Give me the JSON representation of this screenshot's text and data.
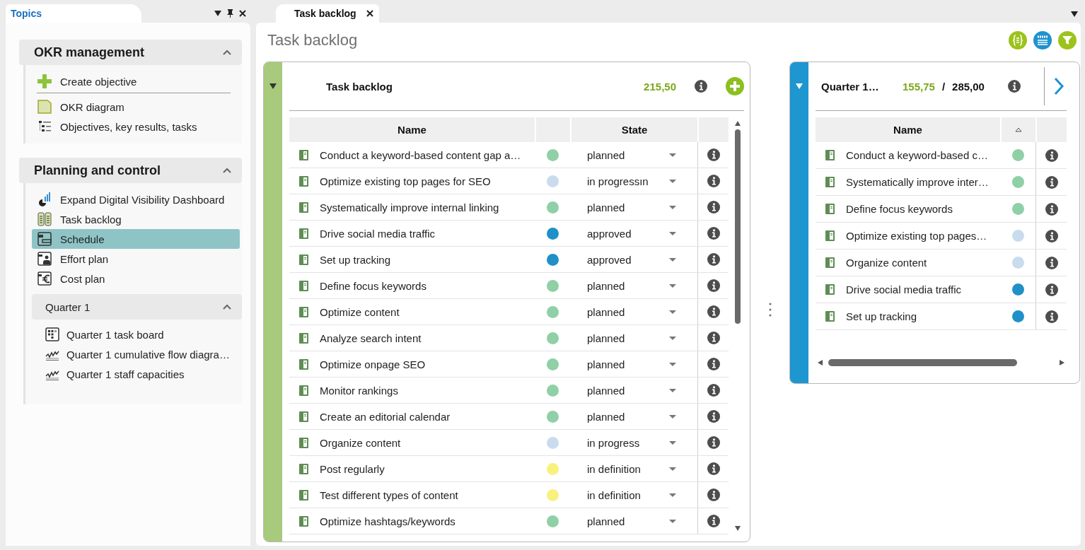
{
  "topics_panel": {
    "tab": {
      "label": "Topics",
      "selected": true
    },
    "sections": [
      {
        "title": "OKR management",
        "expanded": true,
        "items": [
          {
            "label": "Create objective",
            "kind": "create",
            "selected": false
          },
          {
            "label": "OKR diagram",
            "kind": "diagram",
            "selected": false
          },
          {
            "label": "Objectives, key results, tasks",
            "kind": "outline",
            "selected": false
          }
        ]
      },
      {
        "title": "Planning and control",
        "expanded": true,
        "items": [
          {
            "label": "Expand Digital Visibility Dashboard",
            "kind": "dashboard",
            "selected": false
          },
          {
            "label": "Task backlog",
            "kind": "backlog",
            "selected": false
          },
          {
            "label": "Schedule",
            "kind": "schedule",
            "selected": true
          },
          {
            "label": "Effort plan",
            "kind": "effort",
            "selected": false
          },
          {
            "label": "Cost plan",
            "kind": "cost",
            "selected": false
          }
        ],
        "groups": [
          {
            "title": "Quarter 1",
            "expanded": true,
            "items": [
              {
                "label": "Quarter 1 task board",
                "kind": "board",
                "selected": false
              },
              {
                "label": "Quarter 1 cumulative flow diagra…",
                "kind": "chart",
                "selected": false
              },
              {
                "label": "Quarter 1 staff capacities",
                "kind": "chart",
                "selected": false
              }
            ]
          }
        ]
      }
    ]
  },
  "document_tabs": [
    {
      "label": "Task backlog",
      "selected": true
    }
  ],
  "page": {
    "title": "Task backlog"
  },
  "backlog": {
    "title": "Task backlog",
    "expanded": true,
    "total": "215,50",
    "name_column": "Name",
    "state_column": "State",
    "rows": [
      {
        "name": "Conduct a keyword-based content gap a…",
        "color": "#8fd0a6",
        "state": "planned"
      },
      {
        "name": "Optimize existing top pages for SEO",
        "color": "#c9dced",
        "state": "in progressın"
      },
      {
        "name": "Systematically improve internal linking",
        "color": "#8fd0a6",
        "state": "planned"
      },
      {
        "name": "Drive social media traffic",
        "color": "#1f90c8",
        "state": "approved"
      },
      {
        "name": "Set up tracking",
        "color": "#1f90c8",
        "state": "approved"
      },
      {
        "name": "Define focus keywords",
        "color": "#8fd0a6",
        "state": "planned"
      },
      {
        "name": "Optimize content",
        "color": "#8fd0a6",
        "state": "planned"
      },
      {
        "name": "Analyze search intent",
        "color": "#8fd0a6",
        "state": "planned"
      },
      {
        "name": "Optimize onpage SEO",
        "color": "#8fd0a6",
        "state": "planned"
      },
      {
        "name": "Monitor rankings",
        "color": "#8fd0a6",
        "state": "planned"
      },
      {
        "name": "Create an editorial calendar",
        "color": "#8fd0a6",
        "state": "planned"
      },
      {
        "name": "Organize content",
        "color": "#c9dced",
        "state": "in progress"
      },
      {
        "name": "Post regularly",
        "color": "#f9f17d",
        "state": "in definition"
      },
      {
        "name": "Test different types of content",
        "color": "#f9f17d",
        "state": "in definition"
      },
      {
        "name": "Optimize hashtags/keywords",
        "color": "#8fd0a6",
        "state": "planned"
      }
    ]
  },
  "iteration": {
    "title": "Quarter 1…",
    "expanded": true,
    "used": "155,75",
    "separator": "/",
    "capacity": "285,00",
    "name_column": "Name",
    "sort_ascending": true,
    "rows": [
      {
        "name": "Conduct a keyword-based c…",
        "color": "#8fd0a6"
      },
      {
        "name": "Systematically improve inter…",
        "color": "#8fd0a6"
      },
      {
        "name": "Define focus keywords",
        "color": "#8fd0a6"
      },
      {
        "name": "Optimize existing top pages…",
        "color": "#c9dced"
      },
      {
        "name": "Organize content",
        "color": "#c9dced"
      },
      {
        "name": "Drive social media traffic",
        "color": "#1f90c8"
      },
      {
        "name": "Set up tracking",
        "color": "#1f90c8"
      }
    ]
  }
}
